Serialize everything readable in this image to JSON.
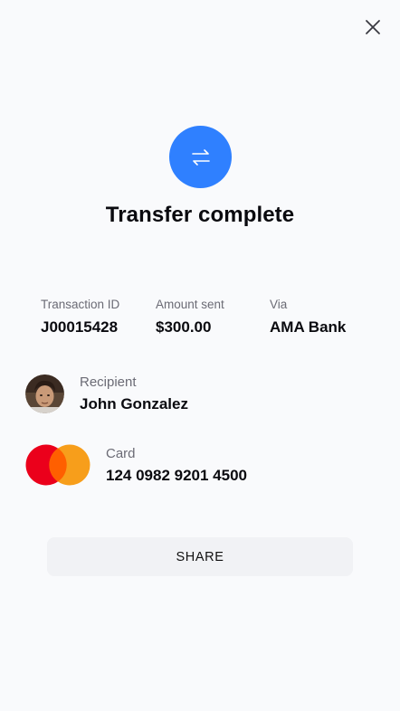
{
  "header": {
    "close_icon": "close-icon"
  },
  "hero": {
    "icon": "transfer-arrows-icon",
    "accent_color": "#2f80ff",
    "title": "Transfer complete"
  },
  "details": [
    {
      "label": "Transaction ID",
      "value": "J00015428"
    },
    {
      "label": "Amount sent",
      "value": "$300.00"
    },
    {
      "label": "Via",
      "value": "AMA Bank"
    }
  ],
  "recipient": {
    "label": "Recipient",
    "name": "John Gonzalez",
    "avatar_icon": "avatar"
  },
  "card": {
    "label": "Card",
    "number": "124 0982 9201 4500",
    "logo_icon": "mastercard-logo",
    "colors": {
      "left": "#eb001b",
      "right": "#f79e1b"
    }
  },
  "actions": {
    "share_label": "SHARE"
  }
}
